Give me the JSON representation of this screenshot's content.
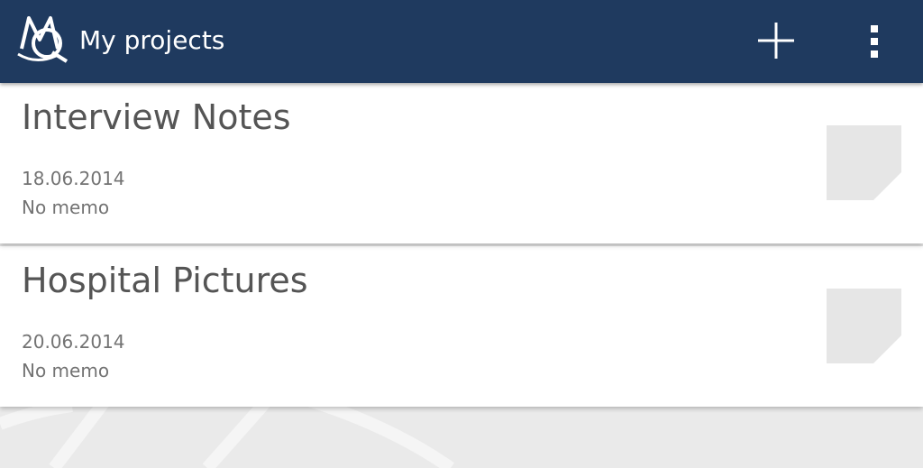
{
  "appbar": {
    "title": "My projects",
    "logo_icon": "mq-logo-icon",
    "add_icon": "plus-icon",
    "menu_icon": "overflow-menu-icon",
    "background_color": "#1f3a5f"
  },
  "projects": [
    {
      "title": "Interview Notes",
      "date": "18.06.2014",
      "memo": "No memo",
      "thumbnail_icon": "note-placeholder-icon"
    },
    {
      "title": "Hospital Pictures",
      "date": "20.06.2014",
      "memo": "No memo",
      "thumbnail_icon": "note-placeholder-icon"
    }
  ]
}
